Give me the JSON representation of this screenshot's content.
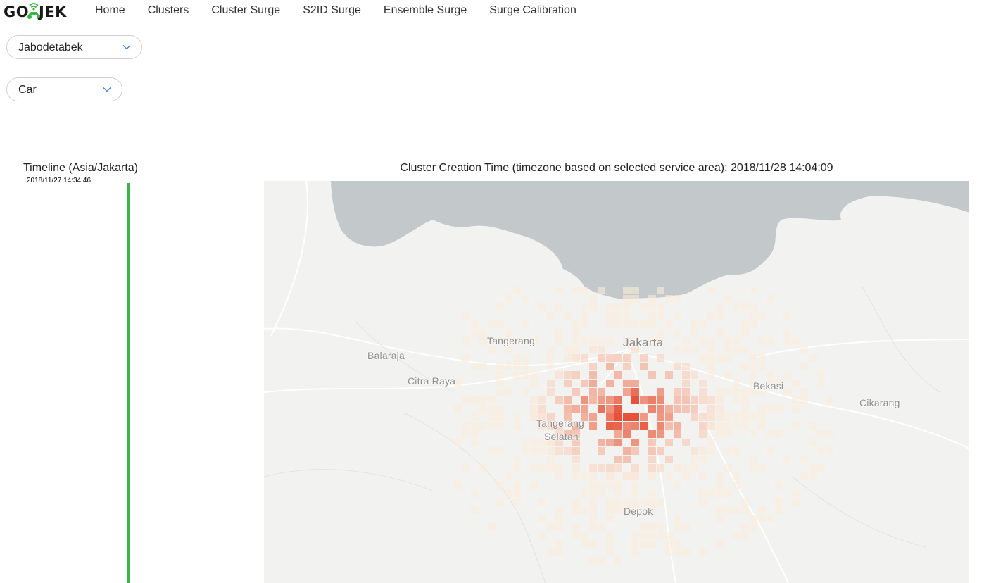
{
  "brand": {
    "logo_left": "GO",
    "logo_right": "JEK",
    "accent": "#3cb44b"
  },
  "nav": {
    "items": [
      "Home",
      "Clusters",
      "Cluster Surge",
      "S2ID Surge",
      "Ensemble Surge",
      "Surge Calibration"
    ]
  },
  "filters": {
    "region": {
      "value": "Jabodetabek",
      "icon": "chevron-down-icon"
    },
    "vehicle": {
      "value": "Car",
      "icon": "chevron-down-icon"
    }
  },
  "timeline": {
    "title": "Timeline (Asia/Jakarta)",
    "start_time": "2018/11/27 14:34:46",
    "color": "#3cb44b"
  },
  "map": {
    "title": "Cluster Creation Time (timezone based on selected service area): 2018/11/28 14:04:09",
    "places": [
      "Tangerang",
      "Jakarta",
      "Balaraja",
      "Citra Raya",
      "Bekasi",
      "Cikarang",
      "Tangerang",
      "Selatan",
      "Depok"
    ],
    "colors": {
      "land": "#f2f2f1",
      "water": "#c3c9ca",
      "heat_low": "#fde9d2",
      "heat_high": "#e4492e"
    }
  }
}
